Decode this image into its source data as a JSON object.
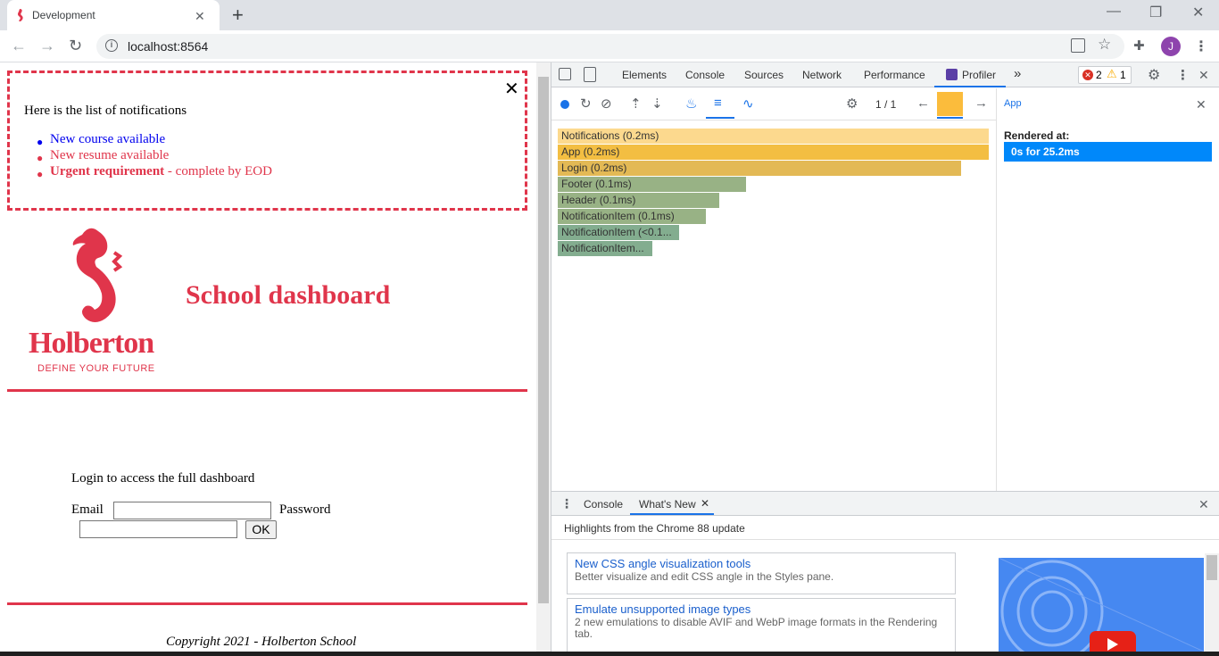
{
  "browser": {
    "tab_title": "Development",
    "tab_close": "✕",
    "new_tab": "+",
    "url": "localhost:8564",
    "avatar_letter": "J",
    "window_minimize": "—",
    "window_restore": "❐",
    "window_close": "✕"
  },
  "page": {
    "notifications": {
      "close": "✕",
      "title": "Here is the list of notifications",
      "items": [
        {
          "text": "New course available",
          "color": "#0000ee"
        },
        {
          "text": "New resume available",
          "color": "#e0354b"
        },
        {
          "strong": "Urgent requirement",
          "rest": " - complete by EOD",
          "color": "#e0354b"
        }
      ]
    },
    "logo": {
      "brand": "Holberton",
      "tagline": "DEFINE YOUR FUTURE"
    },
    "dashboard_title": "School dashboard",
    "login": {
      "intro": "Login to access the full dashboard",
      "email_label": "Email",
      "password_label": "Password",
      "ok_label": "OK"
    },
    "footer": "Copyright 2021 - Holberton School"
  },
  "devtools": {
    "tabs": [
      "Elements",
      "Console",
      "Sources",
      "Network",
      "Performance",
      "Profiler"
    ],
    "more": "»",
    "errors": "2",
    "warnings": "1",
    "profiler": {
      "commit_counter": "1 / 1",
      "flame": [
        {
          "label": "Notifications (0.2ms)",
          "color": "#fcd98e"
        },
        {
          "label": "App (0.2ms)",
          "color": "#f3be42"
        },
        {
          "label": "Login (0.2ms)",
          "color": "#e3b955"
        },
        {
          "label": "Footer (0.1ms)",
          "color": "#98b285"
        },
        {
          "label": "Header (0.1ms)",
          "color": "#98b285"
        },
        {
          "label": "NotificationItem (0.1ms)",
          "color": "#98b285"
        },
        {
          "label": "NotificationItem (<0.1...",
          "color": "#83ad8f"
        },
        {
          "label": "NotificationItem...",
          "color": "#83ad8f"
        }
      ],
      "selected_component": "App",
      "rendered_at_label": "Rendered at:",
      "rendered_at_value": "0s for 25.2ms"
    },
    "drawer": {
      "tabs": [
        "Console",
        "What's New"
      ],
      "highlights": "Highlights from the Chrome 88 update",
      "cards": [
        {
          "title": "New CSS angle visualization tools",
          "desc": "Better visualize and edit CSS angle in the Styles pane."
        },
        {
          "title": "Emulate unsupported image types",
          "desc": "2 new emulations to disable AVIF and WebP image formats in the Rendering tab."
        }
      ]
    }
  }
}
